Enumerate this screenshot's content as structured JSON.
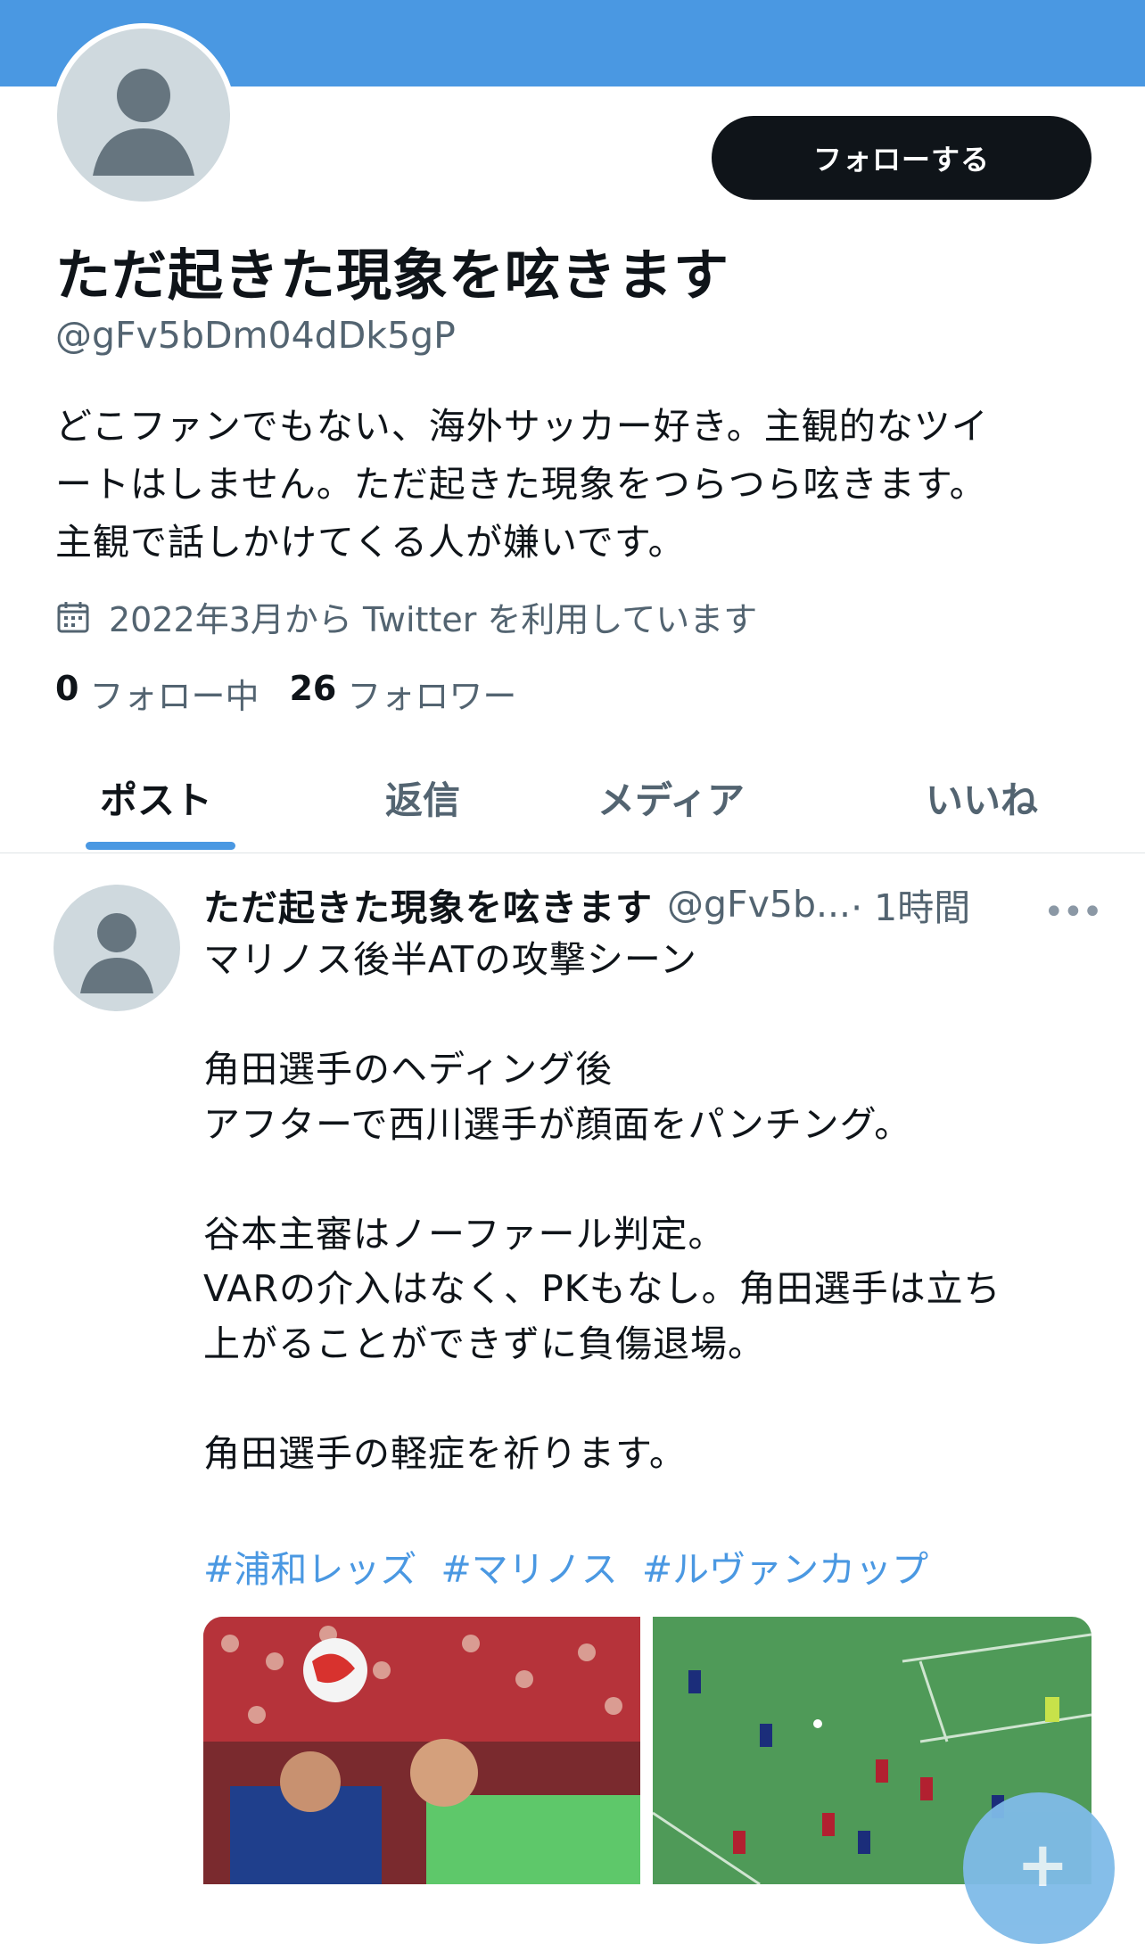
{
  "profile": {
    "name": "ただ起きた現象を呟きます",
    "handle": "@gFv5bDm04dDk5gP",
    "bio_lines": [
      "どこファンでもない、海外サッカー好き。主観的なツイ",
      "ートはしません。ただ起きた現象をつらつら呟きます。",
      "主観で話しかけてくる人が嫌いです。"
    ],
    "joined": "2022年3月から Twitter を利用しています",
    "following_count": "0",
    "following_label": "フォロー中",
    "followers_count": "26",
    "followers_label": "フォロワー"
  },
  "actions": {
    "follow_label": "フォローする"
  },
  "tabs": [
    {
      "label": "ポスト",
      "active": true
    },
    {
      "label": "返信",
      "active": false
    },
    {
      "label": "メディア",
      "active": false
    },
    {
      "label": "いいね",
      "active": false
    }
  ],
  "post": {
    "author_name": "ただ起きた現象を呟きます",
    "author_handle": "@gFv5b...",
    "time": "· 1時間",
    "more_icon": "more-icon",
    "text_lines": [
      "マリノス後半ATの攻撃シーン",
      "",
      "角田選手のヘディング後",
      "アフターで西川選手が顔面をパンチング。",
      "",
      "谷本主審はノーファール判定。",
      "VARの介入はなく、PKもなし。角田選手は立ち",
      "上がることができずに負傷退場。",
      "",
      "角田選手の軽症を祈ります。"
    ],
    "hashtags": [
      "#浦和レッズ",
      "#マリノス",
      "#ルヴァンカップ"
    ]
  },
  "colors": {
    "accent": "#4a98e2",
    "text": "#0f1419",
    "muted": "#536471",
    "button": "#0f1419"
  },
  "icons": {
    "calendar": "calendar-icon",
    "compose": "compose-plus-icon"
  }
}
